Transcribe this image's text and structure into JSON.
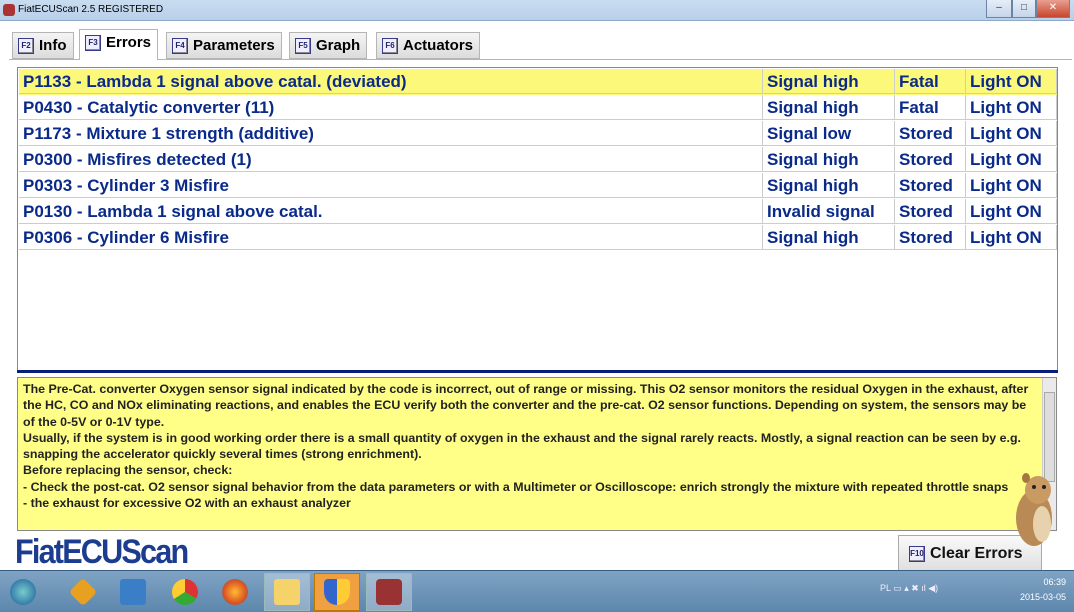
{
  "window": {
    "title": "FiatECUScan 2.5 REGISTERED",
    "minimize": "–",
    "maximize": "□",
    "close": "✕"
  },
  "tabs": [
    {
      "key": "F2",
      "label": "Info"
    },
    {
      "key": "F3",
      "label": "Errors"
    },
    {
      "key": "F4",
      "label": "Parameters"
    },
    {
      "key": "F5",
      "label": "Graph"
    },
    {
      "key": "F6",
      "label": "Actuators"
    }
  ],
  "errors": [
    {
      "code": "P1133 - Lambda 1 signal above catal. (deviated)",
      "status": "Signal high",
      "type": "Fatal",
      "light": "Light ON"
    },
    {
      "code": "P0430 - Catalytic converter (11)",
      "status": "Signal high",
      "type": "Fatal",
      "light": "Light ON"
    },
    {
      "code": "P1173 - Mixture 1 strength (additive)",
      "status": "Signal low",
      "type": "Stored",
      "light": "Light ON"
    },
    {
      "code": "P0300 - Misfires detected (1)",
      "status": "Signal high",
      "type": "Stored",
      "light": "Light ON"
    },
    {
      "code": "P0303 - Cylinder 3 Misfire",
      "status": "Signal high",
      "type": "Stored",
      "light": "Light ON"
    },
    {
      "code": "P0130 - Lambda 1 signal above catal.",
      "status": "Invalid signal",
      "type": "Stored",
      "light": "Light ON"
    },
    {
      "code": "P0306 - Cylinder 6 Misfire",
      "status": "Signal high",
      "type": "Stored",
      "light": "Light ON"
    }
  ],
  "description": [
    "The Pre-Cat. converter Oxygen sensor signal indicated by the code is incorrect, out of range or missing. This O2 sensor monitors the residual Oxygen in the exhaust, after the HC, CO and NOx eliminating reactions, and enables the ECU verify both the converter and the pre-cat. O2 sensor functions. Depending on system, the sensors may be of the 0-5V or 0-1V type.",
    "Usually, if the system is in good working order there is a small quantity of oxygen in the exhaust and the signal rarely reacts. Mostly, a signal reaction can be seen by e.g. snapping the accelerator quickly several times (strong enrichment).",
    "Before replacing the sensor, check:",
    "- Check the post-cat. O2 sensor signal behavior from the data parameters or with a Multimeter or Oscilloscope: enrich strongly the mixture with repeated throttle snaps",
    "- the exhaust for excessive O2 with an exhaust analyzer"
  ],
  "logo": "FiatECUScan",
  "clear_button": {
    "key": "F10",
    "label": "Clear Errors"
  },
  "taskbar": {
    "lang": "PL",
    "time": "06:39",
    "date": "2015-03-05"
  },
  "colors": {
    "selected_row": "#fbf87a",
    "text_blue": "#0a2a8a",
    "desc_bg": "#ffff88"
  }
}
